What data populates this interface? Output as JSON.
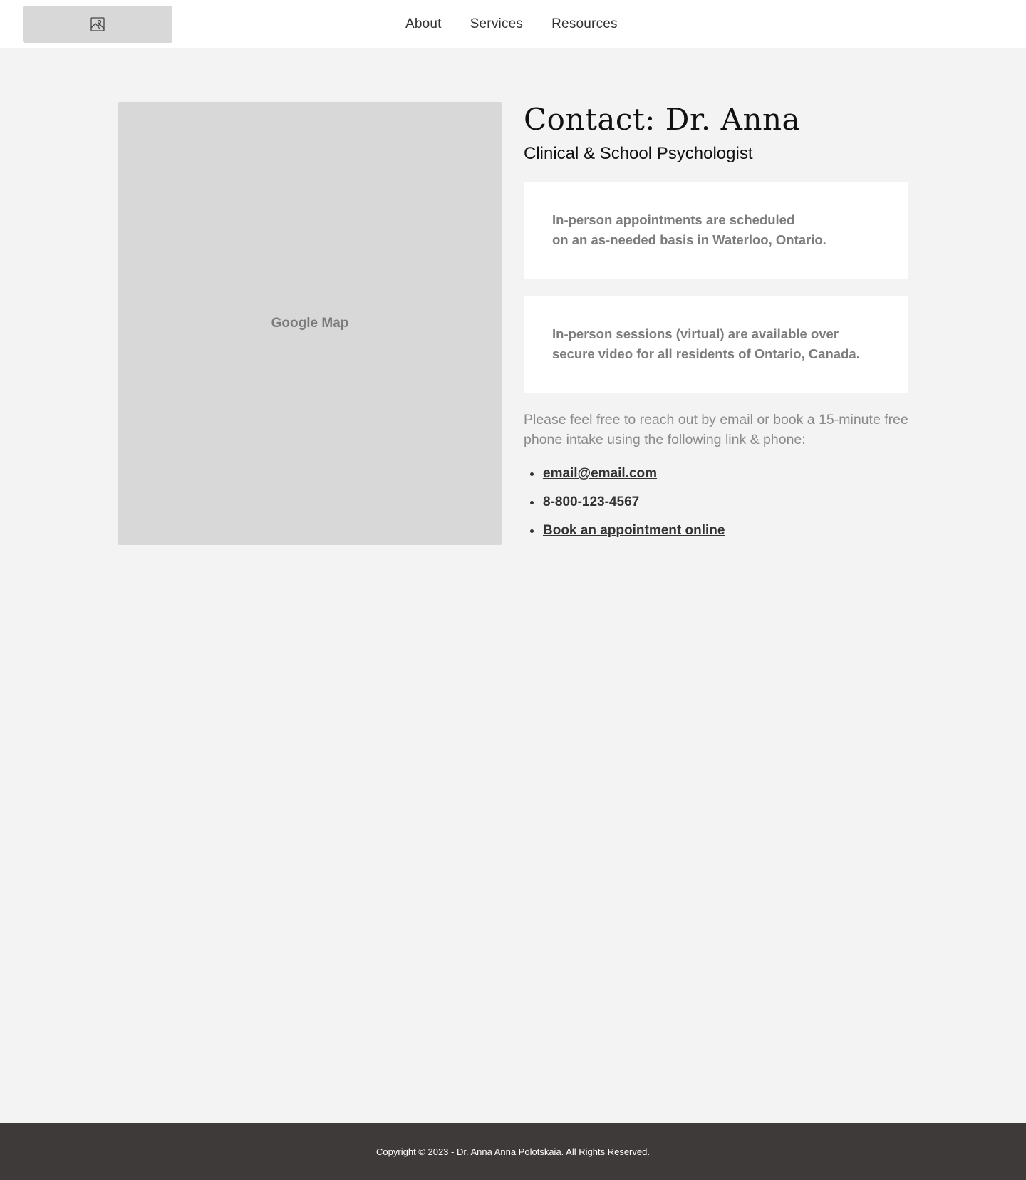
{
  "header": {
    "logo_icon": "image-placeholder-icon",
    "nav": [
      {
        "label": "About"
      },
      {
        "label": "Services"
      },
      {
        "label": "Resources"
      }
    ]
  },
  "map": {
    "label": "Google Map"
  },
  "contact": {
    "title": "Contact: Dr. Anna",
    "subtitle": "Clinical & School Psychologist",
    "cards": [
      {
        "line1": "In-person appointments are scheduled",
        "line2": "on an as-needed basis in Waterloo, Ontario."
      },
      {
        "line1": "In-person sessions (virtual) are available over",
        "line2": "secure video for all residents of Ontario, Canada."
      }
    ],
    "intro": "Please feel free to reach out by email or book a 15-minute free phone intake using the following link & phone:",
    "email": "email@email.com",
    "phone": "8-800-123-4567",
    "booking_link": "Book an appointment online"
  },
  "footer": {
    "copyright": "Copyright © 2023 - Dr. Anna Anna Polotskaia. All Rights Reserved."
  },
  "colors": {
    "page_bg": "#f3f3f3",
    "placeholder": "#d8d8d8",
    "footer_bg": "#3d3a39"
  }
}
